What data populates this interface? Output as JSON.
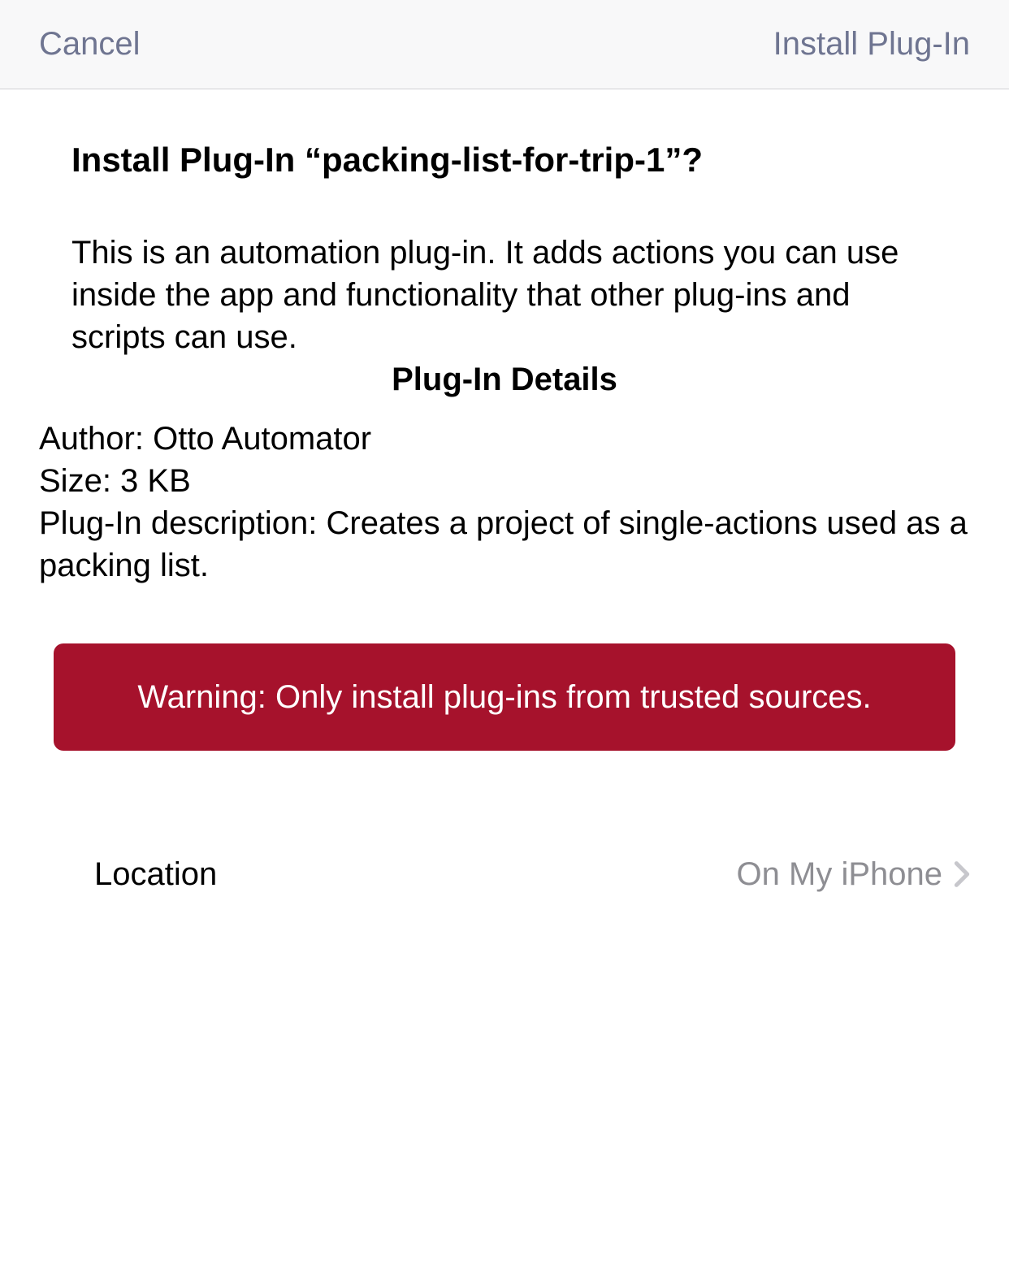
{
  "header": {
    "cancel_label": "Cancel",
    "install_label": "Install Plug-In"
  },
  "main": {
    "title": "Install Plug-In “packing-list-for-trip-1”?",
    "description": "This is an automation plug-in. It adds actions you can use inside the app and functionality that other plug-ins and scripts can use.",
    "section_title": "Plug-In Details",
    "details": {
      "author_label": "Author: ",
      "author_value": "Otto Automator",
      "size_label": "Size: ",
      "size_value": "3 KB",
      "desc_label": "Plug-In description: ",
      "desc_value": "Creates a project of single-actions used as a packing list."
    },
    "warning": "Warning: Only install plug-ins from trusted sources.",
    "location": {
      "label": "Location",
      "value": "On My iPhone"
    }
  }
}
